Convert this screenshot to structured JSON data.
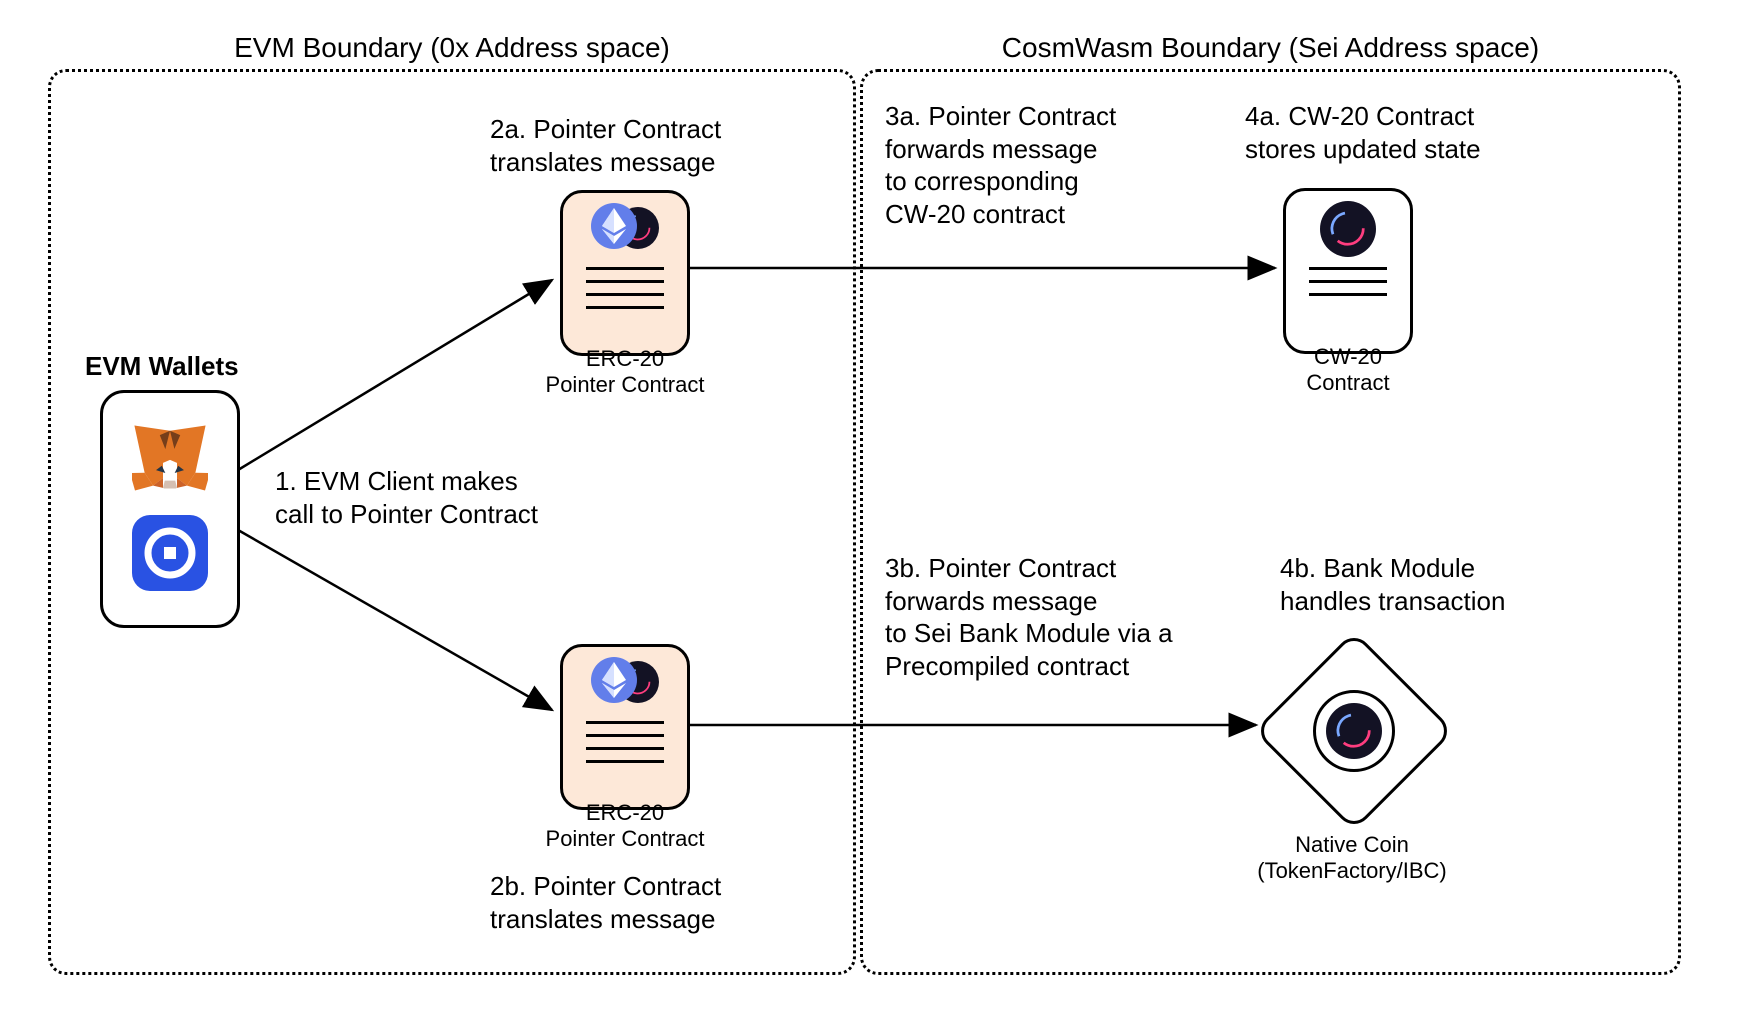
{
  "boundaries": {
    "evm_title": "EVM Boundary (0x Address space)",
    "cosmwasm_title": "CosmWasm Boundary (Sei Address space)"
  },
  "wallets": {
    "title": "EVM Wallets"
  },
  "step1": "1. EVM Client makes\ncall to Pointer Contract",
  "step2a": "2a. Pointer Contract\ntranslates message",
  "step2b": "2b. Pointer Contract\ntranslates message",
  "step3a": "3a. Pointer Contract\nforwards message\nto corresponding\nCW-20 contract",
  "step3b": "3b. Pointer Contract\nforwards message\nto Sei Bank Module via a\nPrecompiled contract",
  "step4a": "4a. CW-20 Contract\nstores updated state",
  "step4b": "4b. Bank Module\nhandles transaction",
  "contract_labels": {
    "erc20_pointer_a": "ERC-20\nPointer Contract",
    "erc20_pointer_b": "ERC-20\nPointer Contract",
    "cw20": "CW-20\nContract",
    "native_coin": "Native Coin\n(TokenFactory/IBC)"
  },
  "icons": {
    "metamask": "metamask-icon",
    "coinbase": "coinbase-icon",
    "ethereum": "ethereum-icon",
    "sei": "sei-icon"
  }
}
